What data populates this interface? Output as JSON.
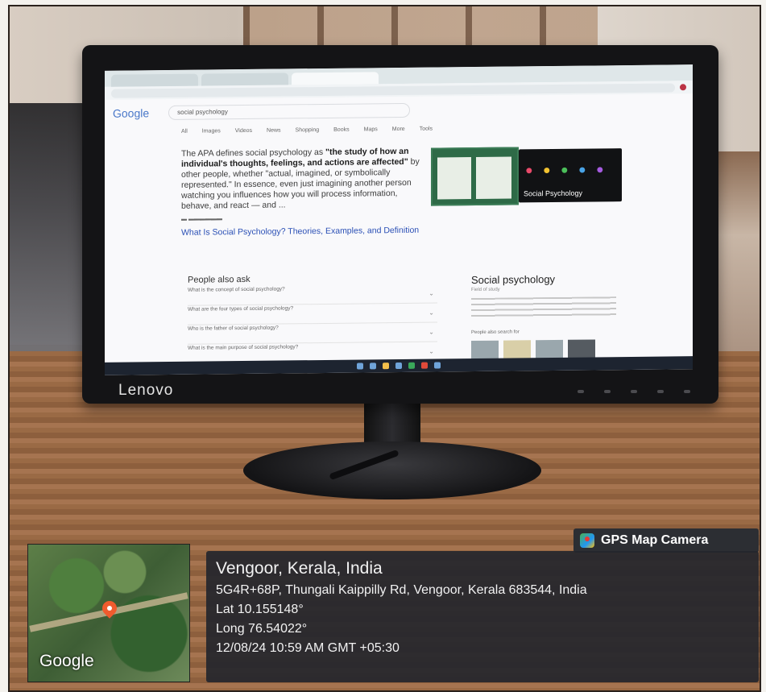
{
  "photo": {
    "monitor_brand": "Lenovo",
    "browser": {
      "tabs": [
        "",
        "",
        ""
      ],
      "search_engine_logo": "Google",
      "query": "social psychology",
      "filters": [
        "All",
        "Images",
        "Videos",
        "News",
        "Shopping",
        "Books",
        "Maps",
        "More",
        "Tools"
      ],
      "snippet_prefix": "The APA defines social psychology as ",
      "snippet_bold": "\"the study of how an individual's thoughts, feelings, and actions are affected\"",
      "snippet_suffix": " by other people, whether \"actual, imagined, or symbolically represented.\" In essence, even just imagining another person watching you influences how you will process information, behave, and react — and ...",
      "result_title": "What Is Social Psychology? Theories, Examples, and Definition",
      "image_caption": "Social Psychology",
      "people_also_ask_title": "People also ask",
      "people_also_ask": [
        "What is the concept of social psychology?",
        "What are the four types of social psychology?",
        "Who is the father of social psychology?",
        "What is the main purpose of social psychology?"
      ],
      "knowledge_panel_title": "Social psychology",
      "knowledge_panel_subtitle": "Field of study",
      "people_also_search": "People also search for"
    }
  },
  "gps_overlay": {
    "app_name": "GPS Map Camera",
    "map_label": "Google",
    "place": "Vengoor, Kerala, India",
    "address": "5G4R+68P, Thungali Kaippilly Rd, Vengoor, Kerala 683544, India",
    "lat": "Lat 10.155148°",
    "long": "Long 76.54022°",
    "datetime": "12/08/24 10:59 AM GMT +05:30",
    "colors": {
      "pin": "#ef5b2e",
      "panel": "#24262c"
    },
    "icons": [
      "gps-map-camera-icon",
      "map-pin-icon"
    ]
  }
}
